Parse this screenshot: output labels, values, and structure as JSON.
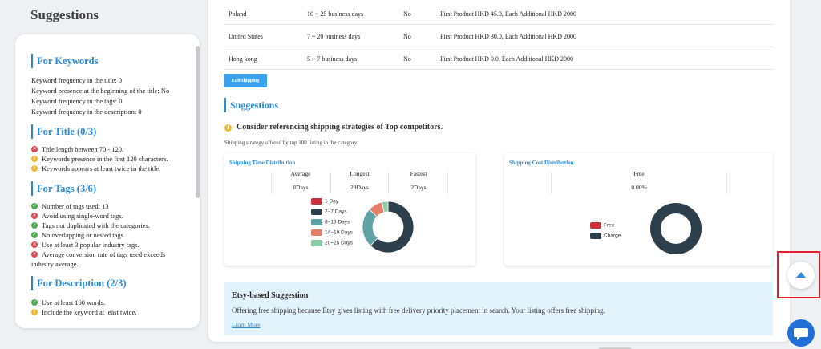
{
  "left": {
    "title": "Suggestions",
    "keywords": {
      "heading": "For Keywords",
      "lines": [
        "Keyword frequency in the title: 0",
        "Keyword presence at the beginning of the title: No",
        "Keyword frequency in the tags: 0",
        "Keyword frequency in the description: 0"
      ]
    },
    "title_section": {
      "heading": "For Title (0/3)",
      "items": [
        {
          "status": "bad",
          "text": "Title length between 70 - 120."
        },
        {
          "status": "warn",
          "text": "Keywords presence in the first 120 characters."
        },
        {
          "status": "warn",
          "text": "Keywords appears at least twice in the title."
        }
      ]
    },
    "tags_section": {
      "heading": "For Tags (3/6)",
      "items": [
        {
          "status": "ok",
          "text": "Number of tags used: 13"
        },
        {
          "status": "bad",
          "text": "Avoid using single-word tags."
        },
        {
          "status": "ok",
          "text": "Tags not duplicated with the categories."
        },
        {
          "status": "ok",
          "text": "No overlapping or nested tags."
        },
        {
          "status": "bad",
          "text": "Use at least 3 popular industry tags."
        },
        {
          "status": "bad",
          "text": "Average conversion rate of tags used exceeds industry average."
        }
      ]
    },
    "description_section": {
      "heading": "For Description (2/3)",
      "items": [
        {
          "status": "ok",
          "text": "Use at least 160 words."
        },
        {
          "status": "warn",
          "text": "Include the keyword at least twice."
        }
      ]
    }
  },
  "shipping_rows": [
    {
      "country": "Poland",
      "days": "10 ~ 25 business days",
      "free": "No",
      "cost": "First Product HKD 45.0, Each Additional HKD 2000"
    },
    {
      "country": "United States",
      "days": "7 ~ 20 business days",
      "free": "No",
      "cost": "First Product HKD 30.0, Each Additional HKD 2000"
    },
    {
      "country": "Hong kong",
      "days": "5 ~ 7 business days",
      "free": "No",
      "cost": "First Product HKD 0.0, Each Additional HKD 2000"
    }
  ],
  "edit_shipping_label": "Edit shipping",
  "suggestions_heading": "Suggestions",
  "consider_text": "Consider referencing shipping strategies of Top competitors.",
  "strategy_note": "Shipping strategy offered by top 100 listing in the category.",
  "time_dist": {
    "title": "Shipping Time Distribution",
    "stats": [
      {
        "label": "Average",
        "value": "8Days"
      },
      {
        "label": "Longest",
        "value": "29Days"
      },
      {
        "label": "Fastest",
        "value": "2Days"
      }
    ]
  },
  "cost_dist": {
    "title": "Shipping Cost Distribution",
    "stat": {
      "label": "Free",
      "value": "0.00%"
    }
  },
  "chart_data": [
    {
      "type": "pie",
      "title": "Shipping Time Distribution",
      "categories": [
        "1 Day",
        "2~7 Days",
        "8~13 Days",
        "14~19 Days",
        "20~25 Days"
      ],
      "values": [
        0,
        62,
        25,
        9,
        4
      ],
      "colors": [
        "#c8323a",
        "#2e3f4c",
        "#5ea3a5",
        "#e0806a",
        "#8ecba8"
      ],
      "legend": "left"
    },
    {
      "type": "pie",
      "title": "Shipping Cost Distribution",
      "categories": [
        "Free",
        "Charge"
      ],
      "values": [
        0,
        100
      ],
      "colors": [
        "#c8323a",
        "#2e3f4c"
      ],
      "legend": "left"
    }
  ],
  "etsy": {
    "title": "Etsy-based Suggestion",
    "text": "Offering free shipping because Etsy gives listing with free delivery priority placement in search. Your listing offers free shipping.",
    "link": "Learn More"
  }
}
